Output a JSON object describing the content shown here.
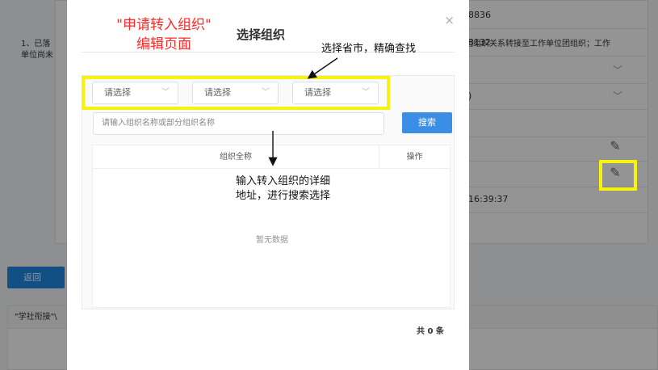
{
  "background": {
    "rows": [
      {
        "text": "8836",
        "chevron": false
      },
      {
        "text": "3132",
        "chevron": false
      },
      {
        "text": "",
        "chevron": true
      },
      {
        "text": ")",
        "chevron": true
      },
      {
        "text": "",
        "chevron": false
      },
      {
        "text": "",
        "chevron": false
      },
      {
        "text": "",
        "chevron": false
      },
      {
        "text": "16:39:37",
        "chevron": false
      }
    ],
    "back_label": "返回",
    "panel_header": "\"学社衔接\"\\",
    "panel_text_left": "1、已落\n单位尚未",
    "panel_text_right": "团组织关系转接至工作单位团组织；工作"
  },
  "modal": {
    "title": "选择组织",
    "close_glyph": "×",
    "selects": [
      {
        "placeholder": "请选择"
      },
      {
        "placeholder": "请选择"
      },
      {
        "placeholder": "请选择"
      }
    ],
    "search_placeholder": "请输入组织名称或部分组织名称",
    "search_button": "搜索",
    "table": {
      "columns": [
        "组织全称",
        "操作"
      ],
      "empty_text": "暂无数据"
    },
    "total_text": "共 0 条"
  },
  "annotations": {
    "red_title_line1": "\"申请转入组织\"",
    "red_title_line2": "编辑页面",
    "note_province": "选择省市，精确查找",
    "note_detail_line1": "输入转入组织的详细",
    "note_detail_line2": "地址，进行搜索选择",
    "highlight_color": "#f7f30c",
    "red_color": "#ff2a2a"
  }
}
